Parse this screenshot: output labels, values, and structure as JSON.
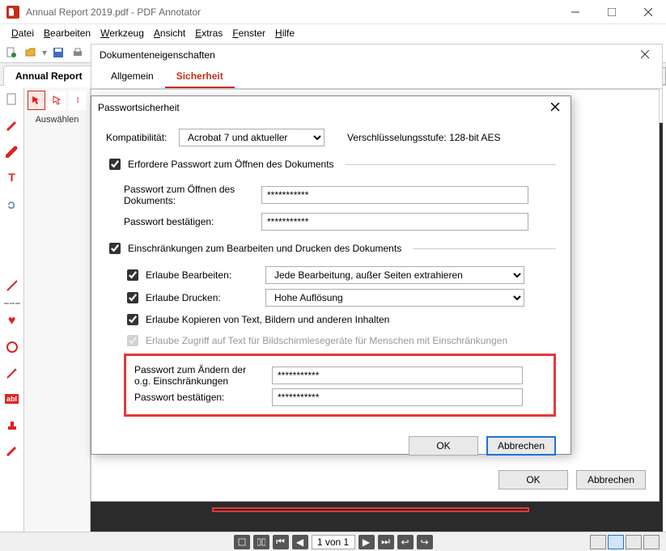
{
  "window": {
    "title": "Annual Report 2019.pdf - PDF Annotator"
  },
  "menu": {
    "file": "Datei",
    "edit": "Bearbeiten",
    "tool": "Werkzeug",
    "view": "Ansicht",
    "extras": "Extras",
    "window": "Fenster",
    "help": "Hilfe"
  },
  "docprops": {
    "title": "Dokumenteneigenschaften",
    "tab_general": "Allgemein",
    "tab_security": "Sicherheit",
    "ok": "OK",
    "cancel": "Abbrechen"
  },
  "doctab": {
    "label": "Annual Report"
  },
  "toolcol": {
    "select_label": "Auswählen"
  },
  "pwd": {
    "title": "Passwortsicherheit",
    "compat_label": "Kompatibilität:",
    "compat_value": "Acrobat 7 und aktueller",
    "enc_label": "Verschlüsselungsstufe: 128-bit AES",
    "require_open": "Erfordere Passwort zum Öffnen des Dokuments",
    "open_pw_label": "Passwort zum Öffnen des Dokuments:",
    "open_pw_value": "***********",
    "confirm_label": "Passwort bestätigen:",
    "confirm_value": "***********",
    "restrict": "Einschränkungen zum Bearbeiten und Drucken des Dokuments",
    "allow_edit": "Erlaube Bearbeiten:",
    "allow_edit_value": "Jede  Bearbeitung, außer Seiten extrahieren",
    "allow_print": "Erlaube Drucken:",
    "allow_print_value": "Hohe Auflösung",
    "allow_copy": "Erlaube Kopieren von Text, Bildern und anderen Inhalten",
    "allow_access": "Erlaube Zugriff auf Text für Bildschirmlesegeräte für Menschen mit Einschränkungen",
    "change_pw_label": "Passwort zum Ändern der o.g. Einschränkungen",
    "change_pw_value": "***********",
    "change_confirm_label": "Passwort bestätigen:",
    "change_confirm_value": "***********",
    "ok": "OK",
    "cancel": "Abbrechen"
  },
  "status": {
    "page": "1 von 1"
  }
}
